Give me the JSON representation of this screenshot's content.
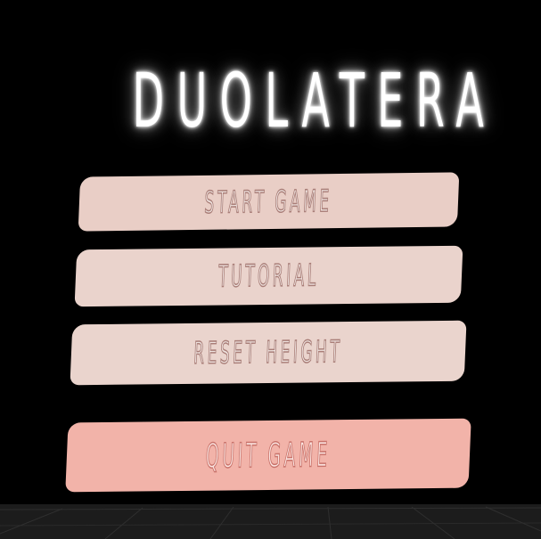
{
  "game": {
    "title": "DUOLATERA"
  },
  "menu": {
    "start_label": "START GAME",
    "tutorial_label": "TUTORIAL",
    "reset_label": "RESET HEIGHT",
    "quit_label": "QUIT GAME"
  },
  "colors": {
    "background": "#000000",
    "button": "#e9cec6",
    "quit_button": "#f2b3a9",
    "title_glow": "#ffffff",
    "floor": "#1c1c1c"
  }
}
